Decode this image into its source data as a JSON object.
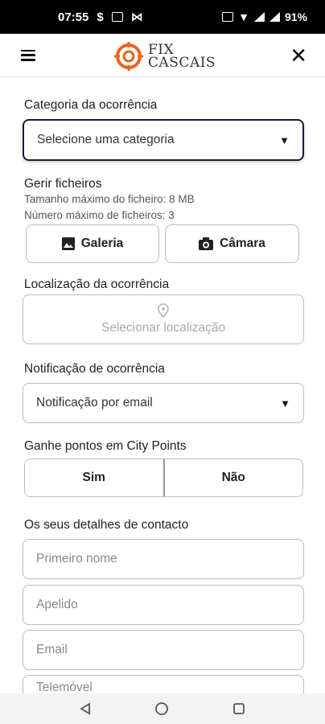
{
  "status_bar": {
    "time": "07:55",
    "battery": "91%"
  },
  "app": {
    "logo_line1": "FIX",
    "logo_line2": "CASCAIS"
  },
  "form": {
    "category": {
      "label": "Categoria da ocorrência",
      "value": "Selecione uma categoria"
    },
    "files": {
      "label": "Gerir ficheiros",
      "max_size": "Tamanho máximo do ficheiro: 8 MB",
      "max_count": "Número máximo de ficheiros: 3",
      "gallery_button": "Galeria",
      "camera_button": "Câmara"
    },
    "location": {
      "label": "Localização da ocorrência",
      "placeholder": "Selecionar localização"
    },
    "notification": {
      "label": "Notificação de ocorrência",
      "value": "Notificação por email"
    },
    "city_points": {
      "label": "Ganhe pontos em City Points",
      "yes": "Sim",
      "no": "Não"
    },
    "contact": {
      "label": "Os seus detalhes de contacto",
      "first_name_placeholder": "Primeiro nome",
      "last_name_placeholder": "Apelido",
      "email_placeholder": "Email",
      "phone_placeholder": "Telemóvel"
    }
  },
  "colors": {
    "accent": "#e8661e",
    "focus_border": "#1b1b3a"
  }
}
